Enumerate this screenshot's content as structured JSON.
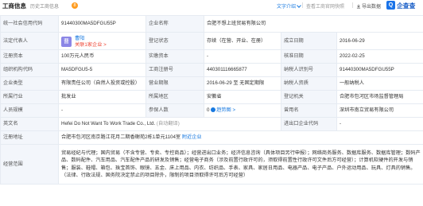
{
  "header": {
    "title": "工商信息",
    "history_label": "历史工商信息",
    "history_count": "8",
    "copy_text": "文字介绍",
    "gov_link": "查看工商官网快照",
    "export": "导出数据",
    "logo_text": "企查查"
  },
  "rows": {
    "credit_code_label": "统一社会信用代码",
    "credit_code": "91440300MA5DFGU55P",
    "company_name_label": "企业名称",
    "company_name": "合肥不想上班贸易有限公司",
    "legal_rep_label": "法定代表人",
    "legal_rep_avatar": "曹",
    "legal_rep_name": "曹阳",
    "legal_rep_link": "关联1家企业 >",
    "status_label": "登记状态",
    "status": "存续（在营、开业、在册）",
    "established_label": "成立日期",
    "established": "2016-06-29",
    "reg_capital_label": "注册资本",
    "reg_capital": "100万元人民币",
    "paid_capital_label": "实缴资本",
    "paid_capital": "-",
    "approved_label": "核准日期",
    "approved": "2022-02-25",
    "org_code_label": "组织机构代码",
    "org_code": "MA5DFGU5-5",
    "biz_reg_label": "工商注册号",
    "biz_reg": "440301116665877",
    "taxpayer_id_label": "纳税人识别号",
    "taxpayer_id": "91440300MA5DFGU55P",
    "type_label": "企业类型",
    "type": "有限责任公司（自然人投资或控股）",
    "term_label": "营业期限",
    "term": "2016-06-29 至 无固定期限",
    "taxpayer_q_label": "纳税人资质",
    "taxpayer_q": "一般纳税人",
    "industry_label": "所属行业",
    "industry": "批发业",
    "region_label": "所属地区",
    "region": "安徽省",
    "authority_label": "登记机关",
    "authority": "合肥市包河区市场监督管理局",
    "staff_label": "人员规模",
    "staff": "-",
    "insured_label": "参保人数",
    "insured": "0",
    "insured_trend": "趋势图 >",
    "former_name_label": "曾用名",
    "former_name": "深圳市南立贸易有限公司",
    "en_name_label": "英文名",
    "en_name": "Hefei Do Not Want To Work Trade Co., Ltd.",
    "en_name_tag": "(自动翻译)",
    "imp_exp_label": "进出口企业代码",
    "imp_exp": "-",
    "address_label": "注册地址",
    "address": "合肥市包河区南京路江花月二期香榭苑2栋1单元1104室",
    "address_link": "附近企业",
    "scope_label": "经营范围",
    "scope": "贸易经纪与代理；国内贸易（不含专营、专卖、专控商品）；经营进出口业务；经济信息咨询（具体项目另行申报）；网络商务服务、数据库服务、数据库管理；数码产品、数码配件、汽车用品、汽车配件产品的研发及销售；经营电子商务（涉及前置行政许可的，须取得前置性行政许可文件后方可经营）；计算机软硬件的开发与销售；服装、鞋帽、箱包、珠宝首饰、眼镜、五金、床上用品、内衣、纺织品、手表、家具、家居日用品、电器产品、电子产品、户外运动用品、玩具、灯具的销售。（法律、行政法规、国务院决定禁止的项目除外，限制的项目须取得许可后方可经营）"
  },
  "colors": {
    "accent": "#1879e0",
    "label_bg": "#f3f6fb",
    "border": "#e6ebf2",
    "badge": "#ff9c1f",
    "avatar": "#8b86e6"
  }
}
